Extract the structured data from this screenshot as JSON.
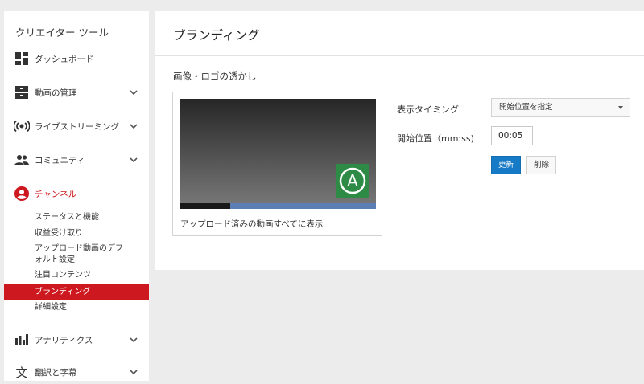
{
  "sidebar": {
    "title": "クリエイター ツール",
    "items": [
      {
        "label": "ダッシュボード",
        "icon": "dashboard-icon"
      },
      {
        "label": "動画の管理",
        "icon": "video-manager-icon"
      },
      {
        "label": "ライブストリーミング",
        "icon": "live-streaming-icon"
      },
      {
        "label": "コミュニティ",
        "icon": "community-icon"
      },
      {
        "label": "チャンネル",
        "icon": "channel-icon"
      },
      {
        "label": "アナリティクス",
        "icon": "analytics-icon"
      },
      {
        "label": "翻訳と字幕",
        "icon": "translate-icon"
      }
    ],
    "channel_sub": [
      "ステータスと機能",
      "収益受け取り",
      "アップロード動画のデフォルト設定",
      "注目コンテンツ",
      "ブランディング",
      "詳細設定"
    ],
    "active_color": "#cc181e"
  },
  "page": {
    "title": "ブランディング"
  },
  "watermark": {
    "section_title": "画像・ロゴの透かし",
    "logo_letter": "A",
    "caption": "アップロード済みの動画すべてに表示",
    "timing_label": "表示タイミング",
    "timing_value": "開始位置を指定",
    "start_label": "開始位置（mm:ss)",
    "start_value": "00:05",
    "update_button": "更新",
    "delete_button": "削除",
    "progress_played": 0.26
  },
  "colors": {
    "primary": "#167ac6",
    "logo_bg": "#2e8b45"
  }
}
